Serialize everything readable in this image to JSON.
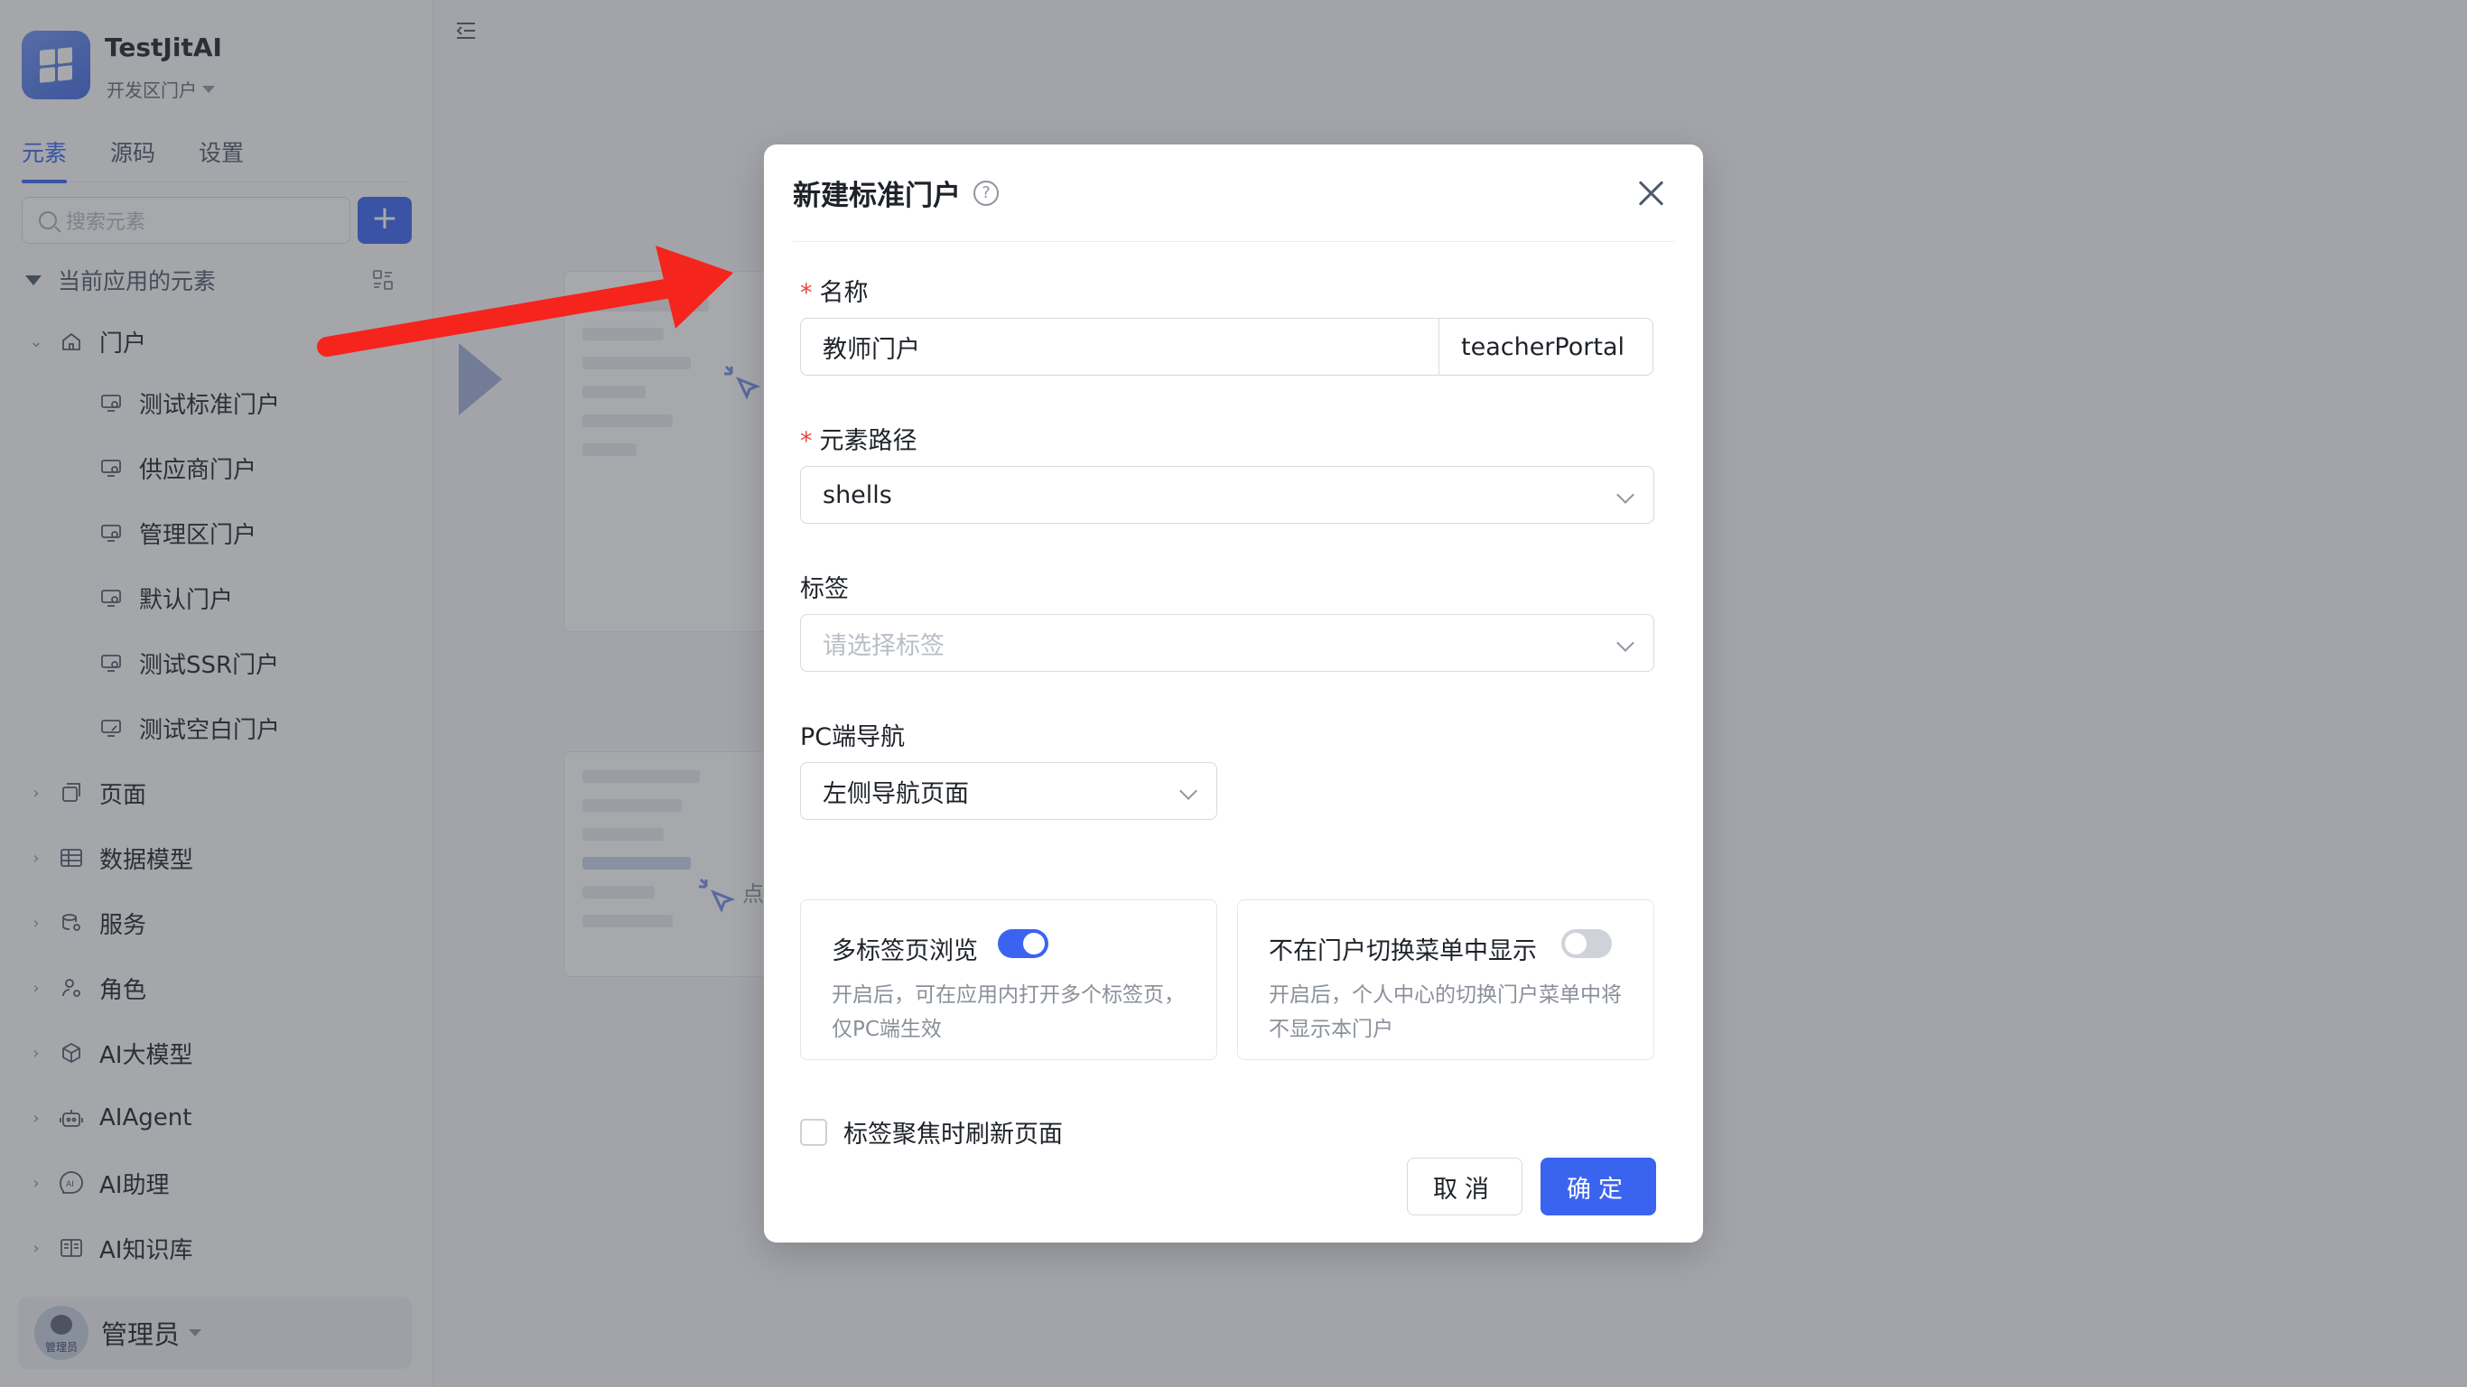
{
  "app": {
    "title": "TestJitAI",
    "subtitle": "开发区门户"
  },
  "sidebar": {
    "tabs": [
      {
        "label": "元素",
        "active": true
      },
      {
        "label": "源码",
        "active": false
      },
      {
        "label": "设置",
        "active": false
      }
    ],
    "search_placeholder": "搜索元素",
    "add_label": "+",
    "group_title": "当前应用的元素",
    "portal_label": "门户",
    "portal_children": [
      "测试标准门户",
      "供应商门户",
      "管理区门户",
      "默认门户",
      "测试SSR门户",
      "测试空白门户"
    ],
    "categories": [
      "页面",
      "数据模型",
      "服务",
      "角色",
      "AI大模型",
      "AIAgent",
      "AI助理",
      "AI知识库"
    ],
    "user": {
      "name": "管理员",
      "avatar_text": "管理员"
    }
  },
  "background": {
    "hint_text": "点"
  },
  "modal": {
    "title": "新建标准门户",
    "help": "?",
    "name_label": "名称",
    "name_value": "教师门户",
    "code_value": "teacherPortal",
    "path_label": "元素路径",
    "path_value": "shells",
    "tags_label": "标签",
    "tags_placeholder": "请选择标签",
    "nav_label": "PC端导航",
    "nav_value": "左侧导航页面",
    "required_mark": "*",
    "cards": [
      {
        "title": "多标签页浏览",
        "desc": "开启后，可在应用内打开多个标签页，仅PC端生效",
        "enabled": true
      },
      {
        "title": "不在门户切换菜单中显示",
        "desc": "开启后，个人中心的切换门户菜单中将不显示本门户",
        "enabled": false
      }
    ],
    "checkbox_label": "标签聚焦时刷新页面",
    "checkbox_checked": false,
    "cancel_label": "取消",
    "ok_label": "确定"
  },
  "colors": {
    "primary": "#3a64f0",
    "required": "#f04438",
    "annotation_arrow": "#f5241c"
  }
}
